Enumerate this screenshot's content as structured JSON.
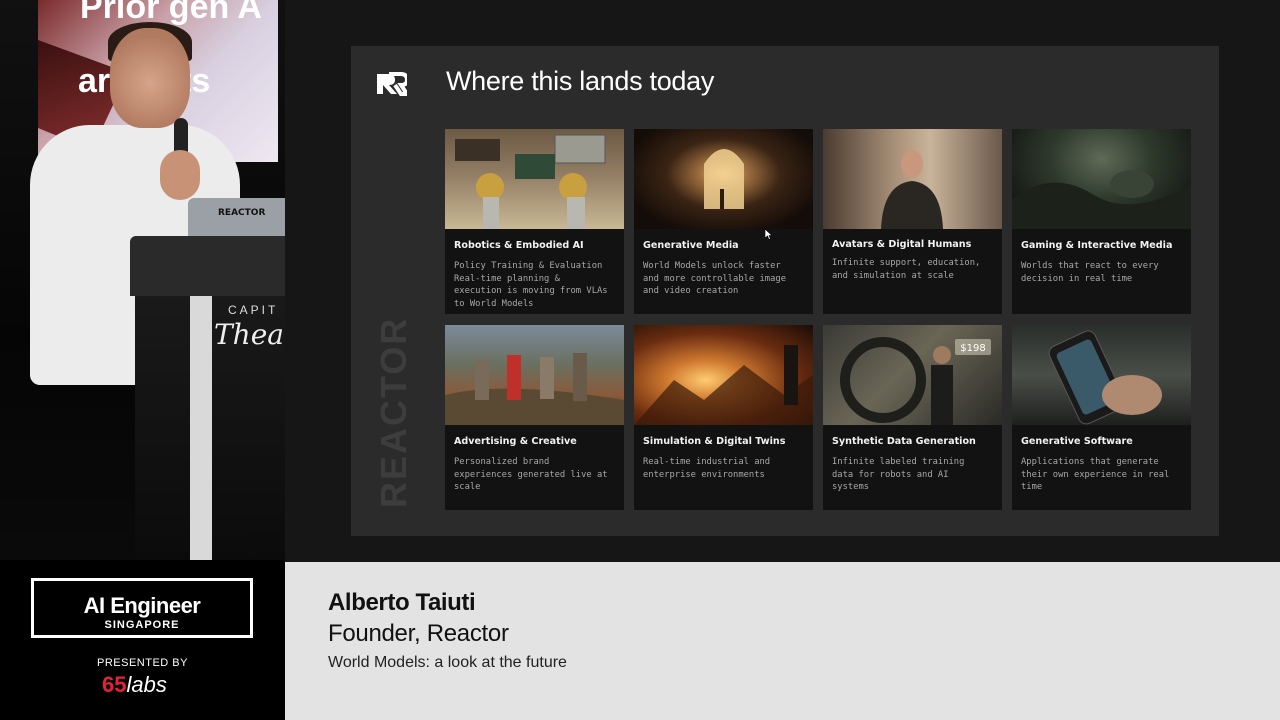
{
  "stage": {
    "screen_text_1": "Prior gen A",
    "screen_text_2": "artifacts",
    "laptop_brand": "REACTOR",
    "podium_brand_1": "CAPIT",
    "podium_brand_2": "Theat"
  },
  "slide": {
    "title": "Where this lands today",
    "watermark": "REACTOR",
    "cards": [
      {
        "title": "Robotics & Embodied AI",
        "desc": "Policy Training & Evaluation\nReal-time planning &\nexecution is moving from VLAs\nto World Models"
      },
      {
        "title": "Generative Media",
        "desc": "World Models unlock faster\nand more controllable image\nand video creation"
      },
      {
        "title": "Avatars & Digital Humans",
        "desc": "Infinite support, education,\nand simulation at scale"
      },
      {
        "title": "Gaming & Interactive Media",
        "desc": "Worlds that react to every\ndecision in real time"
      },
      {
        "title": "Advertising & Creative",
        "desc": "Personalized brand\nexperiences generated live at\nscale"
      },
      {
        "title": "Simulation & Digital Twins",
        "desc": "Real-time industrial and\nenterprise environments"
      },
      {
        "title": "Synthetic Data Generation",
        "desc": "Infinite labeled training\ndata for robots and AI\nsystems",
        "price_tag": "$198"
      },
      {
        "title": "Generative Software",
        "desc": "Applications that generate\ntheir own experience in real\ntime"
      }
    ]
  },
  "branding": {
    "event_title": "AI Engineer",
    "event_location": "SINGAPORE",
    "presented_by": "PRESENTED BY",
    "sponsor_num": "65",
    "sponsor_word": "labs"
  },
  "speaker": {
    "name": "Alberto Taiuti",
    "role": "Founder, Reactor",
    "talk": "World Models: a look at the future"
  },
  "colors": {
    "sponsor_red": "#e4223b",
    "card_bg": "#121212",
    "slide_bg": "#2b2b2b",
    "lower_third_bg": "#e3e3e3"
  }
}
